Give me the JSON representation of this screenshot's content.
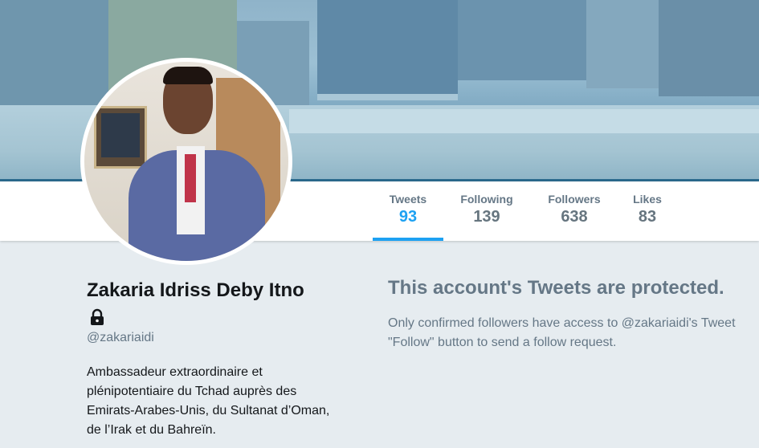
{
  "profile": {
    "name": "Zakaria Idriss Deby Itno",
    "handle": "@zakariaidi",
    "bio": "Ambassadeur extraordinaire et plénipotentiaire du Tchad auprès des Emirats-Arabes-Unis, du Sultanat d’Oman, de l’Irak et du Bahreïn.",
    "lock_icon": "lock-icon",
    "protected": true
  },
  "stats": {
    "tweets": {
      "label": "Tweets",
      "value": "93",
      "active": true
    },
    "following": {
      "label": "Following",
      "value": "139"
    },
    "followers": {
      "label": "Followers",
      "value": "638"
    },
    "likes": {
      "label": "Likes",
      "value": "83"
    }
  },
  "protected_notice": {
    "title": "This account's Tweets are protected.",
    "line1": "Only confirmed followers have access to @zakariaidi's Tweet",
    "line2": "\"Follow\" button to send a follow request."
  },
  "colors": {
    "accent": "#1da1f2",
    "muted_text": "#657786",
    "background": "#e6ecf0"
  }
}
